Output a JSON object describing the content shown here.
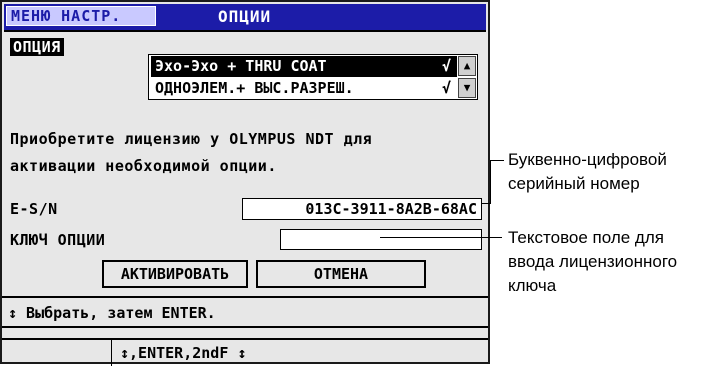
{
  "screen": {
    "menu_tab": "МЕНЮ НАСТР.",
    "title": "ОПЦИИ",
    "option_label": "ОПЦИЯ",
    "options": [
      {
        "label": "Эхо-Эхо + THRU COAT",
        "check": "√",
        "selected": true
      },
      {
        "label": "ОДНОЭЛЕМ.+ ВЫС.РАЗРЕШ.",
        "check": "√",
        "selected": false
      }
    ],
    "scroll_up": "▲",
    "scroll_down": "▼",
    "message_line1": "Приобретите лицензию у OLYMPUS NDT для",
    "message_line2": "активации необходимой опции.",
    "esn_label": "E-S/N",
    "esn_value": "013C-3911-8A2B-68AC",
    "key_label": "КЛЮЧ ОПЦИИ",
    "key_value": "",
    "activate_button": "АКТИВИРОВАТЬ",
    "cancel_button": "ОТМЕНА",
    "hint": "↕ Выбрать, затем ENTER.",
    "keys_hint": "↕,ENTER,2ndF ↕"
  },
  "callouts": {
    "serial_line1": "Буквенно-цифровой",
    "serial_line2": "серийный номер",
    "key_line1": "Текстовое поле для",
    "key_line2": "ввода лицензионного",
    "key_line3": "ключа"
  }
}
